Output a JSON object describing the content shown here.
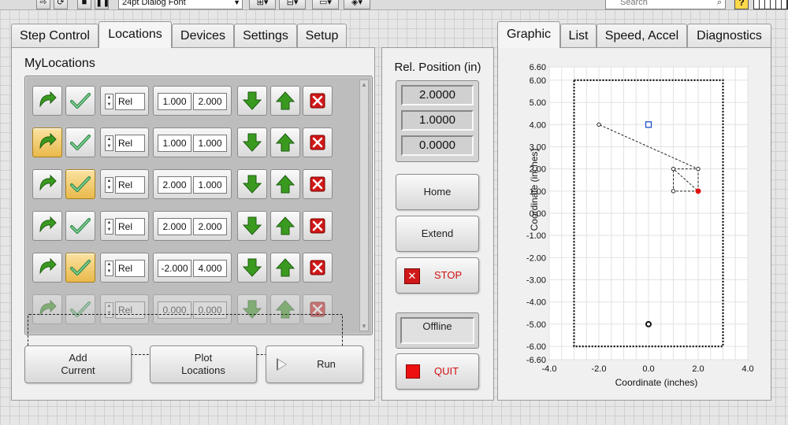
{
  "toolbar": {
    "font_select": "24pt Dialog Font",
    "search_placeholder": "Search",
    "help_label": "?"
  },
  "left_tabs": [
    {
      "label": "Step Control",
      "active": false
    },
    {
      "label": "Locations",
      "active": true
    },
    {
      "label": "Devices",
      "active": false
    },
    {
      "label": "Settings",
      "active": false
    },
    {
      "label": "Setup",
      "active": false
    }
  ],
  "right_tabs": [
    {
      "label": "Graphic",
      "active": true
    },
    {
      "label": "List",
      "active": false
    },
    {
      "label": "Speed, Accel",
      "active": false
    },
    {
      "label": "Diagnostics",
      "active": false
    }
  ],
  "locations": {
    "title": "MyLocations",
    "rows": [
      {
        "mode": "Rel",
        "x": "1.000",
        "y": "2.000",
        "goto_highlight": false,
        "set_highlight": false,
        "ghost": false
      },
      {
        "mode": "Rel",
        "x": "1.000",
        "y": "1.000",
        "goto_highlight": true,
        "set_highlight": false,
        "ghost": false
      },
      {
        "mode": "Rel",
        "x": "2.000",
        "y": "1.000",
        "goto_highlight": false,
        "set_highlight": true,
        "ghost": false
      },
      {
        "mode": "Rel",
        "x": "2.000",
        "y": "2.000",
        "goto_highlight": false,
        "set_highlight": false,
        "ghost": false
      },
      {
        "mode": "Rel",
        "x": "-2.000",
        "y": "4.000",
        "goto_highlight": false,
        "set_highlight": true,
        "ghost": false
      },
      {
        "mode": "Rel",
        "x": "0.000",
        "y": "0.000",
        "goto_highlight": false,
        "set_highlight": false,
        "ghost": true
      }
    ],
    "buttons": {
      "add_current": "Add\nCurrent",
      "plot_locations": "Plot\nLocations",
      "run": "Run"
    }
  },
  "position": {
    "title": "Rel. Position (in)",
    "values": [
      "2.0000",
      "1.0000",
      "0.0000"
    ],
    "home": "Home",
    "extend": "Extend",
    "stop": "STOP",
    "offline": "Offline",
    "quit": "QUIT"
  },
  "colors": {
    "accent_red": "#d01010",
    "highlight_gold": "#e9b94b",
    "arrow_green": "#3a9a20"
  },
  "chart_data": {
    "type": "scatter",
    "xlabel": "Coordinate (inches)",
    "ylabel": "Coordinate (inches)",
    "xlim": [
      -4.0,
      4.0
    ],
    "ylim": [
      -6.6,
      6.6
    ],
    "x_ticks": [
      -4.0,
      -2.0,
      0.0,
      2.0,
      4.0
    ],
    "y_ticks": [
      -6.6,
      -6.0,
      -5.0,
      -4.0,
      -3.0,
      -2.0,
      -1.0,
      0.0,
      1.0,
      2.0,
      3.0,
      4.0,
      5.0,
      6.0,
      6.6
    ],
    "grid": true,
    "boundary": {
      "x": [
        -3.0,
        3.0
      ],
      "y": [
        -6.0,
        6.0
      ]
    },
    "path": [
      [
        2,
        1
      ],
      [
        1,
        1
      ],
      [
        1,
        2
      ],
      [
        2,
        2
      ],
      [
        -2,
        4
      ]
    ],
    "path_extra": [
      [
        2,
        2
      ],
      [
        2,
        1
      ],
      [
        1,
        2
      ]
    ],
    "current_point": [
      2,
      1
    ],
    "marker_square": [
      0,
      4
    ],
    "marker_circle": [
      0,
      -5
    ]
  }
}
